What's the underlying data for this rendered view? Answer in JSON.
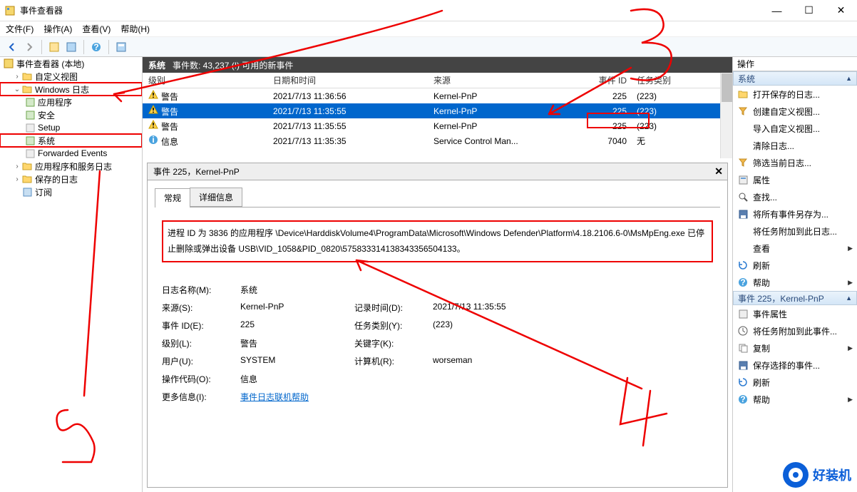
{
  "window": {
    "title": "事件查看器"
  },
  "menu": {
    "file": "文件(F)",
    "action": "操作(A)",
    "view": "查看(V)",
    "help": "帮助(H)"
  },
  "tree": {
    "root": "事件查看器 (本地)",
    "custom": "自定义视图",
    "winlogs": "Windows 日志",
    "app": "应用程序",
    "security": "安全",
    "setup": "Setup",
    "system": "系统",
    "forwarded": "Forwarded Events",
    "appservice": "应用程序和服务日志",
    "saved": "保存的日志",
    "subs": "订阅"
  },
  "mid": {
    "section": "系统",
    "count": "事件数: 43,237 (!) 可用的新事件",
    "cols": {
      "level": "级别",
      "date": "日期和时间",
      "src": "来源",
      "eid": "事件 ID",
      "cat": "任务类别"
    },
    "rows": [
      {
        "level": "警告",
        "date": "2021/7/13 11:36:56",
        "src": "Kernel-PnP",
        "eid": "225",
        "cat": "(223)",
        "type": "warn"
      },
      {
        "level": "警告",
        "date": "2021/7/13 11:35:55",
        "src": "Kernel-PnP",
        "eid": "225",
        "cat": "(223)",
        "type": "warn",
        "sel": true
      },
      {
        "level": "警告",
        "date": "2021/7/13 11:35:55",
        "src": "Kernel-PnP",
        "eid": "225",
        "cat": "(223)",
        "type": "warn"
      },
      {
        "level": "信息",
        "date": "2021/7/13 11:35:35",
        "src": "Service Control Man...",
        "eid": "7040",
        "cat": "无",
        "type": "info"
      }
    ]
  },
  "detail": {
    "header": "事件 225，Kernel-PnP",
    "tabs": {
      "general": "常规",
      "details": "详细信息"
    },
    "message": "进程 ID 为 3836 的应用程序 \\Device\\HarddiskVolume4\\ProgramData\\Microsoft\\Windows Defender\\Platform\\4.18.2106.6-0\\MsMpEng.exe 已停止删除或弹出设备 USB\\VID_1058&PID_0820\\575833314138343356504133。",
    "props": {
      "logname_k": "日志名称(M):",
      "logname_v": "系统",
      "source_k": "来源(S):",
      "source_v": "Kernel-PnP",
      "logged_k": "记录时间(D):",
      "logged_v": "2021/7/13 11:35:55",
      "eid_k": "事件 ID(E):",
      "eid_v": "225",
      "cat_k": "任务类别(Y):",
      "cat_v": "(223)",
      "level_k": "级别(L):",
      "level_v": "警告",
      "kw_k": "关键字(K):",
      "kw_v": "",
      "user_k": "用户(U):",
      "user_v": "SYSTEM",
      "comp_k": "计算机(R):",
      "comp_v": "worseman",
      "opcode_k": "操作代码(O):",
      "opcode_v": "信息",
      "more_k": "更多信息(I):",
      "more_v": "事件日志联机帮助"
    }
  },
  "actions": {
    "header": "操作",
    "sec1": "系统",
    "open_saved": "打开保存的日志...",
    "create_custom": "创建自定义视图...",
    "import_custom": "导入自定义视图...",
    "clear_log": "清除日志...",
    "filter_log": "筛选当前日志...",
    "properties": "属性",
    "find": "查找...",
    "save_all": "将所有事件另存为...",
    "attach_task": "将任务附加到此日志...",
    "view": "查看",
    "refresh": "刷新",
    "help": "帮助",
    "sec2": "事件 225，Kernel-PnP",
    "event_props": "事件属性",
    "attach_event": "将任务附加到此事件...",
    "copy": "复制",
    "save_sel": "保存选择的事件...",
    "refresh2": "刷新",
    "help2": "帮助"
  },
  "watermark": "好装机"
}
